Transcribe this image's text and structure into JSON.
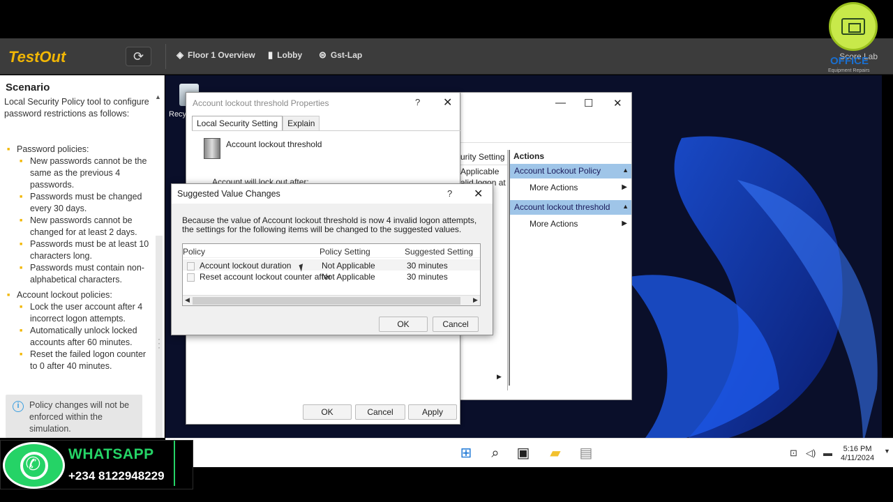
{
  "topbar": {
    "logo": "TestOut",
    "tabs": [
      {
        "label": "Floor 1 Overview",
        "icon": "layers-icon"
      },
      {
        "label": "Lobby",
        "icon": "door-icon"
      },
      {
        "label": "Gst-Lap",
        "icon": "device-icon"
      }
    ],
    "score_label": "Score Lab",
    "brand_overlay": "OFFICE",
    "brand_sub": "Equipment Repairs"
  },
  "scenario": {
    "heading": "Scenario",
    "intro": "Local Security Policy tool to configure password restrictions as follows:",
    "sections": [
      {
        "title": "Password policies:",
        "items": [
          "New passwords cannot be the same as the previous 4 passwords.",
          "Passwords must be changed every 30 days.",
          "New passwords cannot be changed for at least 2 days.",
          "Passwords must be at least 10 characters long.",
          "Passwords must contain non-alphabetical characters."
        ]
      },
      {
        "title": "Account lockout policies:",
        "items": [
          "Lock the user account after 4 incorrect logon attempts.",
          "Automatically unlock locked accounts after 60 minutes.",
          "Reset the failed logon counter to 0 after 40 minutes."
        ]
      }
    ],
    "note": "Policy changes will not be enforced within the simulation."
  },
  "desktop": {
    "recycle_label": "Recy"
  },
  "mmc": {
    "column_partial": "urity Setting",
    "column_values": [
      "Applicable",
      "alid logon at"
    ],
    "actions_title": "Actions",
    "groups": [
      {
        "header": "Account Lockout Policy",
        "item": "More Actions"
      },
      {
        "header": "Account lockout threshold",
        "item": "More Actions"
      }
    ]
  },
  "properties": {
    "title": "Account lockout threshold Properties",
    "help": "?",
    "tabs": [
      "Local Security Setting",
      "Explain"
    ],
    "policy_name": "Account lockout threshold",
    "partial_text": "Account will lock out after:",
    "buttons": {
      "ok": "OK",
      "cancel": "Cancel",
      "apply": "Apply"
    }
  },
  "dialog": {
    "title": "Suggested Value Changes",
    "help": "?",
    "message": "Because the value of Account lockout threshold is now 4 invalid logon attempts, the settings for the following items will be changed to the suggested values.",
    "columns": [
      "Policy",
      "Policy Setting",
      "Suggested Setting"
    ],
    "rows": [
      {
        "policy": "Account lockout duration",
        "setting": "Not Applicable",
        "suggested": "30 minutes"
      },
      {
        "policy": "Reset account lockout counter after",
        "setting": "Not Applicable",
        "suggested": "30 minutes"
      }
    ],
    "ok": "OK",
    "cancel": "Cancel"
  },
  "taskbar": {
    "time": "5:16 PM",
    "date": "4/11/2024"
  },
  "whatsapp": {
    "label": "WHATSAPP",
    "number": "+234 8122948229"
  },
  "colors": {
    "accent": "#f2b705",
    "selection": "#9fc5e8",
    "whatsapp": "#25d366"
  }
}
